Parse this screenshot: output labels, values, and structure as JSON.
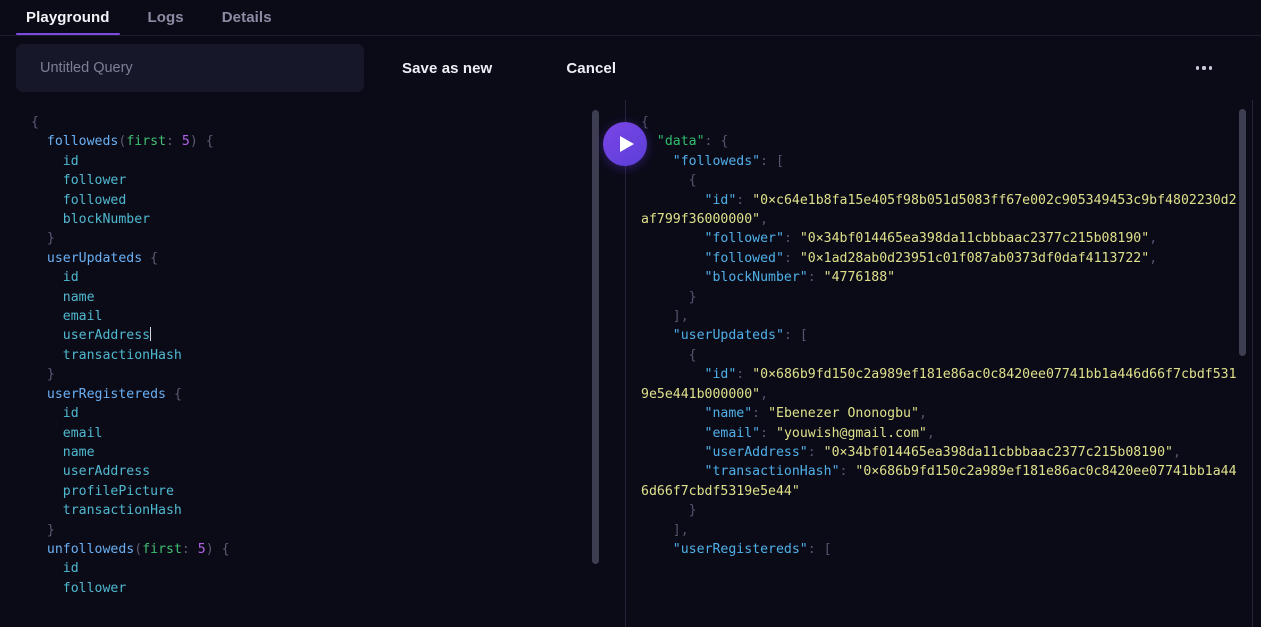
{
  "tabs": [
    {
      "label": "Playground",
      "active": true
    },
    {
      "label": "Logs",
      "active": false
    },
    {
      "label": "Details",
      "active": false
    }
  ],
  "toolbar": {
    "query_name_value": "",
    "query_name_placeholder": "Untitled Query",
    "save_label": "Save as new",
    "cancel_label": "Cancel",
    "more_icon": "kebab-menu-icon"
  },
  "run_button": {
    "icon": "play-icon",
    "color": "#7b45e6"
  },
  "editor": {
    "language": "graphql",
    "caret_after": "userAddress",
    "query_lines": [
      "{",
      "  followeds(first: 5) {",
      "    id",
      "    follower",
      "    followed",
      "    blockNumber",
      "  }",
      "  userUpdateds {",
      "    id",
      "    name",
      "    email",
      "    userAddress",
      "    transactionHash",
      "  }",
      "  userRegistereds {",
      "    id",
      "    email",
      "    name",
      "    userAddress",
      "    profilePicture",
      "    transactionHash",
      "  }",
      "  unfolloweds(first: 5) {",
      "    id",
      "    follower"
    ]
  },
  "result": {
    "data": {
      "followeds": [
        {
          "id": "0×c64e1b8fa15e405f98b051d5083ff67e002c905349453c9bf4802230d2af799f36000000",
          "follower": "0×34bf014465ea398da11cbbbaac2377c215b08190",
          "followed": "0×1ad28ab0d23951c01f087ab0373df0daf4113722",
          "blockNumber": "4776188"
        }
      ],
      "userUpdateds": [
        {
          "id": "0×686b9fd150c2a989ef181e86ac0c8420ee07741bb1a446d66f7cbdf5319e5e441b000000",
          "name": "Ebenezer Ononogbu",
          "email": "youwish@gmail.com",
          "userAddress": "0×34bf014465ea398da11cbbbaac2377c215b08190",
          "transactionHash": "0×686b9fd150c2a989ef181e86ac0c8420ee07741bb1a446d66f7cbdf5319e5e44"
        }
      ],
      "userRegistereds_label": "userRegistereds"
    }
  },
  "scrollbars": {
    "left_thumb": "editor-scrollbar-thumb",
    "right_thumb": "result-scrollbar-thumb"
  },
  "colors": {
    "background": "#0b0b18",
    "accent": "#7b4ae2",
    "input_bg": "#17172a",
    "divider": "#25253a"
  }
}
